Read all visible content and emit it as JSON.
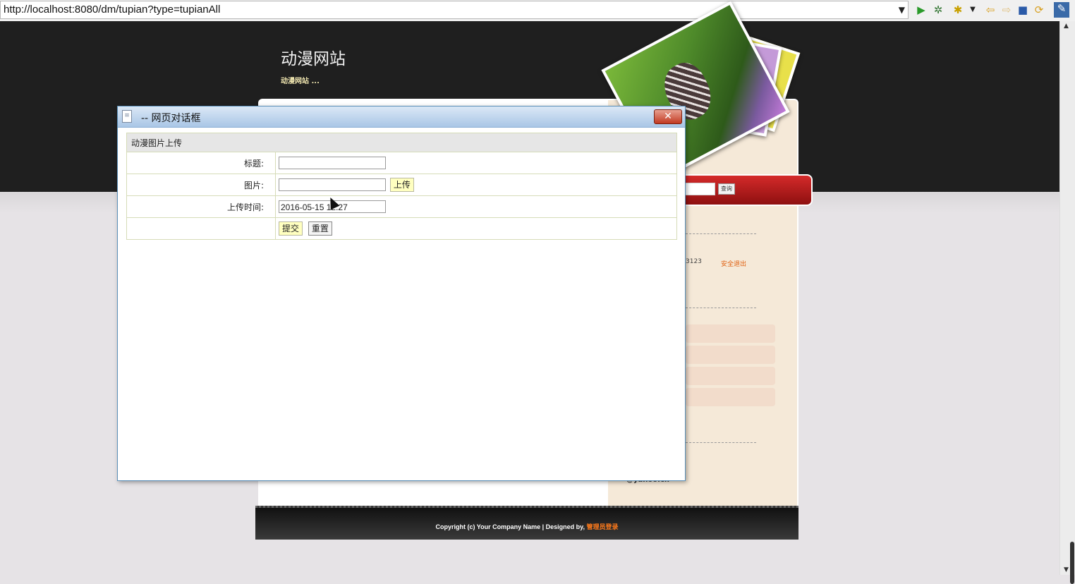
{
  "browser": {
    "url": "http://localhost:8080/dm/tupian?type=tupianAll",
    "toolbar_icons": [
      "run-icon",
      "debug-icon",
      "tools-icon",
      "dropdown-icon",
      "back-icon",
      "forward-icon",
      "stop-icon",
      "refresh-icon",
      "eclipse-icon"
    ]
  },
  "site": {
    "title": "动漫网站",
    "subtitle": "动漫网站 ...",
    "search_button": "查询",
    "side_number": "3123",
    "logout": "安全退出",
    "email_fragment": "@yahoo.cn",
    "footer_text": "Copyright (c) Your Company Name | Designed by,",
    "footer_link": "管理员登录"
  },
  "dialog": {
    "title": "-- 网页对话框",
    "form_header": "动漫图片上传",
    "fields": {
      "title_label": "标题:",
      "title_value": "",
      "image_label": "图片:",
      "image_value": "",
      "upload_button": "上传",
      "time_label": "上传时间:",
      "time_value": "2016-05-15 12:27"
    },
    "submit_button": "提交",
    "reset_button": "重置"
  },
  "colors": {
    "header_dark": "#1f1f1f",
    "sidebar_bg": "#f5e9d8",
    "accent_red": "#c41a1a",
    "dialog_title_bg": "#a9c6e6",
    "yellow_button": "#ffffc0",
    "link_orange": "#ff7a1a"
  }
}
